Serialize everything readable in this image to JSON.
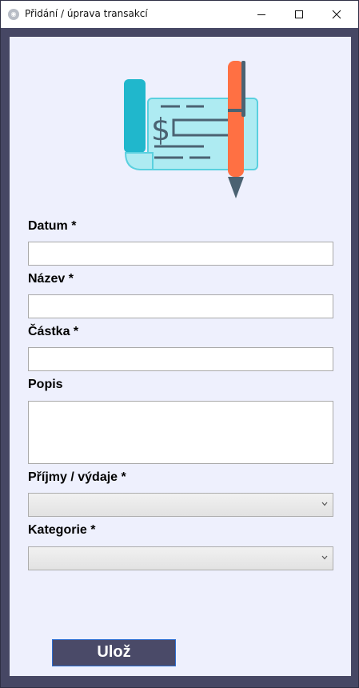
{
  "window": {
    "title": "Přidání / úprava transakcí"
  },
  "form": {
    "datum_label": "Datum *",
    "datum_value": "",
    "nazev_label": "Název *",
    "nazev_value": "",
    "castka_label": "Částka *",
    "castka_value": "",
    "popis_label": "Popis",
    "popis_value": "",
    "prijmy_label": "Příjmy / výdaje *",
    "prijmy_selected": "",
    "kategorie_label": "Kategorie *",
    "kategorie_selected": ""
  },
  "actions": {
    "save_label": "Ulož"
  },
  "icons": {
    "illustration": "check-and-pen-icon",
    "dropdown": "chevron-down-icon"
  },
  "colors": {
    "background": "#eef0fd",
    "frame": "#464764",
    "button": "#4a4a68",
    "button_border": "#2e6fd1"
  }
}
